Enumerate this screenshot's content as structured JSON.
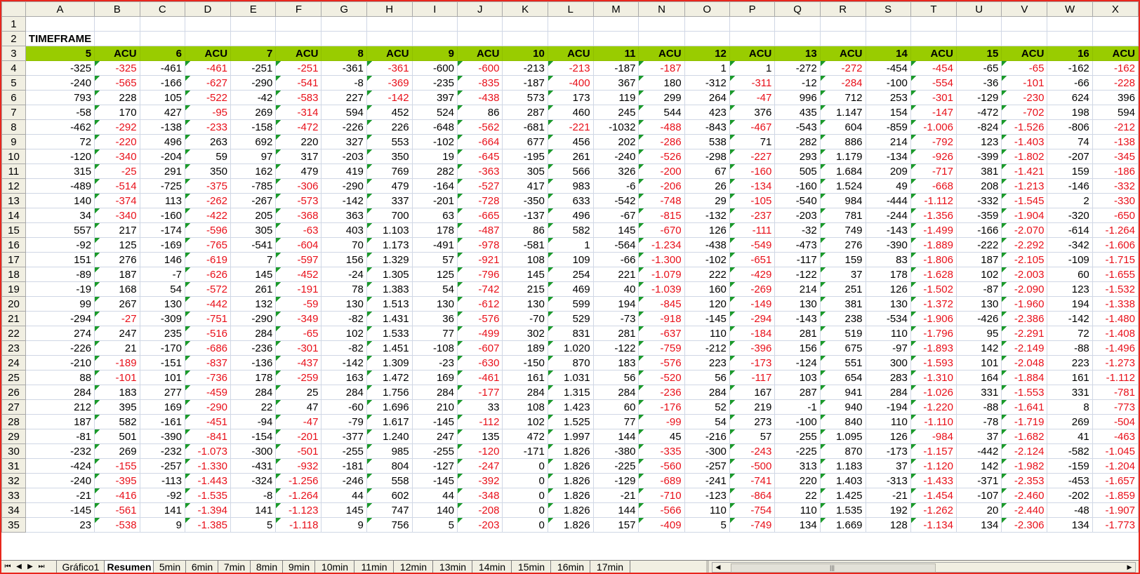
{
  "sheet": {
    "columns": [
      "A",
      "B",
      "C",
      "D",
      "E",
      "F",
      "G",
      "H",
      "I",
      "J",
      "K",
      "L",
      "M",
      "N",
      "O",
      "P",
      "Q",
      "R",
      "S",
      "T",
      "U",
      "V",
      "W",
      "X"
    ],
    "title_cell": "TIMEFRAME",
    "header_row": [
      "5",
      "ACU",
      "6",
      "ACU",
      "7",
      "ACU",
      "8",
      "ACU",
      "9",
      "ACU",
      "10",
      "ACU",
      "11",
      "ACU",
      "12",
      "ACU",
      "13",
      "ACU",
      "14",
      "ACU",
      "15",
      "ACU",
      "16",
      "ACU"
    ],
    "rows": [
      [
        "-325",
        "-325",
        "-461",
        "-461",
        "-251",
        "-251",
        "-361",
        "-361",
        "-600",
        "-600",
        "-213",
        "-213",
        "-187",
        "-187",
        "1",
        "1",
        "-272",
        "-272",
        "-454",
        "-454",
        "-65",
        "-65",
        "-162",
        "-162"
      ],
      [
        "-240",
        "-565",
        "-166",
        "-627",
        "-290",
        "-541",
        "-8",
        "-369",
        "-235",
        "-835",
        "-187",
        "-400",
        "367",
        "180",
        "-312",
        "-311",
        "-12",
        "-284",
        "-100",
        "-554",
        "-36",
        "-101",
        "-66",
        "-228"
      ],
      [
        "793",
        "228",
        "105",
        "-522",
        "-42",
        "-583",
        "227",
        "-142",
        "397",
        "-438",
        "573",
        "173",
        "119",
        "299",
        "264",
        "-47",
        "996",
        "712",
        "253",
        "-301",
        "-129",
        "-230",
        "624",
        "396"
      ],
      [
        "-58",
        "170",
        "427",
        "-95",
        "269",
        "-314",
        "594",
        "452",
        "524",
        "86",
        "287",
        "460",
        "245",
        "544",
        "423",
        "376",
        "435",
        "1.147",
        "154",
        "-147",
        "-472",
        "-702",
        "198",
        "594"
      ],
      [
        "-462",
        "-292",
        "-138",
        "-233",
        "-158",
        "-472",
        "-226",
        "226",
        "-648",
        "-562",
        "-681",
        "-221",
        "-1032",
        "-488",
        "-843",
        "-467",
        "-543",
        "604",
        "-859",
        "-1.006",
        "-824",
        "-1.526",
        "-806",
        "-212"
      ],
      [
        "72",
        "-220",
        "496",
        "263",
        "692",
        "220",
        "327",
        "553",
        "-102",
        "-664",
        "677",
        "456",
        "202",
        "-286",
        "538",
        "71",
        "282",
        "886",
        "214",
        "-792",
        "123",
        "-1.403",
        "74",
        "-138"
      ],
      [
        "-120",
        "-340",
        "-204",
        "59",
        "97",
        "317",
        "-203",
        "350",
        "19",
        "-645",
        "-195",
        "261",
        "-240",
        "-526",
        "-298",
        "-227",
        "293",
        "1.179",
        "-134",
        "-926",
        "-399",
        "-1.802",
        "-207",
        "-345"
      ],
      [
        "315",
        "-25",
        "291",
        "350",
        "162",
        "479",
        "419",
        "769",
        "282",
        "-363",
        "305",
        "566",
        "326",
        "-200",
        "67",
        "-160",
        "505",
        "1.684",
        "209",
        "-717",
        "381",
        "-1.421",
        "159",
        "-186"
      ],
      [
        "-489",
        "-514",
        "-725",
        "-375",
        "-785",
        "-306",
        "-290",
        "479",
        "-164",
        "-527",
        "417",
        "983",
        "-6",
        "-206",
        "26",
        "-134",
        "-160",
        "1.524",
        "49",
        "-668",
        "208",
        "-1.213",
        "-146",
        "-332"
      ],
      [
        "140",
        "-374",
        "113",
        "-262",
        "-267",
        "-573",
        "-142",
        "337",
        "-201",
        "-728",
        "-350",
        "633",
        "-542",
        "-748",
        "29",
        "-105",
        "-540",
        "984",
        "-444",
        "-1.112",
        "-332",
        "-1.545",
        "2",
        "-330"
      ],
      [
        "34",
        "-340",
        "-160",
        "-422",
        "205",
        "-368",
        "363",
        "700",
        "63",
        "-665",
        "-137",
        "496",
        "-67",
        "-815",
        "-132",
        "-237",
        "-203",
        "781",
        "-244",
        "-1.356",
        "-359",
        "-1.904",
        "-320",
        "-650"
      ],
      [
        "557",
        "217",
        "-174",
        "-596",
        "305",
        "-63",
        "403",
        "1.103",
        "178",
        "-487",
        "86",
        "582",
        "145",
        "-670",
        "126",
        "-111",
        "-32",
        "749",
        "-143",
        "-1.499",
        "-166",
        "-2.070",
        "-614",
        "-1.264"
      ],
      [
        "-92",
        "125",
        "-169",
        "-765",
        "-541",
        "-604",
        "70",
        "1.173",
        "-491",
        "-978",
        "-581",
        "1",
        "-564",
        "-1.234",
        "-438",
        "-549",
        "-473",
        "276",
        "-390",
        "-1.889",
        "-222",
        "-2.292",
        "-342",
        "-1.606"
      ],
      [
        "151",
        "276",
        "146",
        "-619",
        "7",
        "-597",
        "156",
        "1.329",
        "57",
        "-921",
        "108",
        "109",
        "-66",
        "-1.300",
        "-102",
        "-651",
        "-117",
        "159",
        "83",
        "-1.806",
        "187",
        "-2.105",
        "-109",
        "-1.715"
      ],
      [
        "-89",
        "187",
        "-7",
        "-626",
        "145",
        "-452",
        "-24",
        "1.305",
        "125",
        "-796",
        "145",
        "254",
        "221",
        "-1.079",
        "222",
        "-429",
        "-122",
        "37",
        "178",
        "-1.628",
        "102",
        "-2.003",
        "60",
        "-1.655"
      ],
      [
        "-19",
        "168",
        "54",
        "-572",
        "261",
        "-191",
        "78",
        "1.383",
        "54",
        "-742",
        "215",
        "469",
        "40",
        "-1.039",
        "160",
        "-269",
        "214",
        "251",
        "126",
        "-1.502",
        "-87",
        "-2.090",
        "123",
        "-1.532"
      ],
      [
        "99",
        "267",
        "130",
        "-442",
        "132",
        "-59",
        "130",
        "1.513",
        "130",
        "-612",
        "130",
        "599",
        "194",
        "-845",
        "120",
        "-149",
        "130",
        "381",
        "130",
        "-1.372",
        "130",
        "-1.960",
        "194",
        "-1.338"
      ],
      [
        "-294",
        "-27",
        "-309",
        "-751",
        "-290",
        "-349",
        "-82",
        "1.431",
        "36",
        "-576",
        "-70",
        "529",
        "-73",
        "-918",
        "-145",
        "-294",
        "-143",
        "238",
        "-534",
        "-1.906",
        "-426",
        "-2.386",
        "-142",
        "-1.480"
      ],
      [
        "274",
        "247",
        "235",
        "-516",
        "284",
        "-65",
        "102",
        "1.533",
        "77",
        "-499",
        "302",
        "831",
        "281",
        "-637",
        "110",
        "-184",
        "281",
        "519",
        "110",
        "-1.796",
        "95",
        "-2.291",
        "72",
        "-1.408"
      ],
      [
        "-226",
        "21",
        "-170",
        "-686",
        "-236",
        "-301",
        "-82",
        "1.451",
        "-108",
        "-607",
        "189",
        "1.020",
        "-122",
        "-759",
        "-212",
        "-396",
        "156",
        "675",
        "-97",
        "-1.893",
        "142",
        "-2.149",
        "-88",
        "-1.496"
      ],
      [
        "-210",
        "-189",
        "-151",
        "-837",
        "-136",
        "-437",
        "-142",
        "1.309",
        "-23",
        "-630",
        "-150",
        "870",
        "183",
        "-576",
        "223",
        "-173",
        "-124",
        "551",
        "300",
        "-1.593",
        "101",
        "-2.048",
        "223",
        "-1.273"
      ],
      [
        "88",
        "-101",
        "101",
        "-736",
        "178",
        "-259",
        "163",
        "1.472",
        "169",
        "-461",
        "161",
        "1.031",
        "56",
        "-520",
        "56",
        "-117",
        "103",
        "654",
        "283",
        "-1.310",
        "164",
        "-1.884",
        "161",
        "-1.112"
      ],
      [
        "284",
        "183",
        "277",
        "-459",
        "284",
        "25",
        "284",
        "1.756",
        "284",
        "-177",
        "284",
        "1.315",
        "284",
        "-236",
        "284",
        "167",
        "287",
        "941",
        "284",
        "-1.026",
        "331",
        "-1.553",
        "331",
        "-781"
      ],
      [
        "212",
        "395",
        "169",
        "-290",
        "22",
        "47",
        "-60",
        "1.696",
        "210",
        "33",
        "108",
        "1.423",
        "60",
        "-176",
        "52",
        "219",
        "-1",
        "940",
        "-194",
        "-1.220",
        "-88",
        "-1.641",
        "8",
        "-773"
      ],
      [
        "187",
        "582",
        "-161",
        "-451",
        "-94",
        "-47",
        "-79",
        "1.617",
        "-145",
        "-112",
        "102",
        "1.525",
        "77",
        "-99",
        "54",
        "273",
        "-100",
        "840",
        "110",
        "-1.110",
        "-78",
        "-1.719",
        "269",
        "-504"
      ],
      [
        "-81",
        "501",
        "-390",
        "-841",
        "-154",
        "-201",
        "-377",
        "1.240",
        "247",
        "135",
        "472",
        "1.997",
        "144",
        "45",
        "-216",
        "57",
        "255",
        "1.095",
        "126",
        "-984",
        "37",
        "-1.682",
        "41",
        "-463"
      ],
      [
        "-232",
        "269",
        "-232",
        "-1.073",
        "-300",
        "-501",
        "-255",
        "985",
        "-255",
        "-120",
        "-171",
        "1.826",
        "-380",
        "-335",
        "-300",
        "-243",
        "-225",
        "870",
        "-173",
        "-1.157",
        "-442",
        "-2.124",
        "-582",
        "-1.045"
      ],
      [
        "-424",
        "-155",
        "-257",
        "-1.330",
        "-431",
        "-932",
        "-181",
        "804",
        "-127",
        "-247",
        "0",
        "1.826",
        "-225",
        "-560",
        "-257",
        "-500",
        "313",
        "1.183",
        "37",
        "-1.120",
        "142",
        "-1.982",
        "-159",
        "-1.204"
      ],
      [
        "-240",
        "-395",
        "-113",
        "-1.443",
        "-324",
        "-1.256",
        "-246",
        "558",
        "-145",
        "-392",
        "0",
        "1.826",
        "-129",
        "-689",
        "-241",
        "-741",
        "220",
        "1.403",
        "-313",
        "-1.433",
        "-371",
        "-2.353",
        "-453",
        "-1.657"
      ],
      [
        "-21",
        "-416",
        "-92",
        "-1.535",
        "-8",
        "-1.264",
        "44",
        "602",
        "44",
        "-348",
        "0",
        "1.826",
        "-21",
        "-710",
        "-123",
        "-864",
        "22",
        "1.425",
        "-21",
        "-1.454",
        "-107",
        "-2.460",
        "-202",
        "-1.859"
      ],
      [
        "-145",
        "-561",
        "141",
        "-1.394",
        "141",
        "-1.123",
        "145",
        "747",
        "140",
        "-208",
        "0",
        "1.826",
        "144",
        "-566",
        "110",
        "-754",
        "110",
        "1.535",
        "192",
        "-1.262",
        "20",
        "-2.440",
        "-48",
        "-1.907"
      ],
      [
        "23",
        "-538",
        "9",
        "-1.385",
        "5",
        "-1.118",
        "9",
        "756",
        "5",
        "-203",
        "0",
        "1.826",
        "157",
        "-409",
        "5",
        "-749",
        "134",
        "1.669",
        "128",
        "-1.134",
        "134",
        "-2.306",
        "134",
        "-1.773"
      ]
    ],
    "colors": {
      "header_fill": "#99cc00",
      "negative": "#e8101a",
      "frame": "#e8261c",
      "chrome": "#f1efe2"
    }
  },
  "tabs": {
    "nav": [
      "⏮",
      "◀",
      "▶",
      "⏭"
    ],
    "items": [
      "Gráfico1",
      "Resumen",
      "5min",
      "6min",
      "7min",
      "8min",
      "9min",
      "10min",
      "11min",
      "12min",
      "13min",
      "14min",
      "15min",
      "16min",
      "17min"
    ],
    "active_index": 1
  },
  "hscroll": {
    "grip": "|||"
  }
}
